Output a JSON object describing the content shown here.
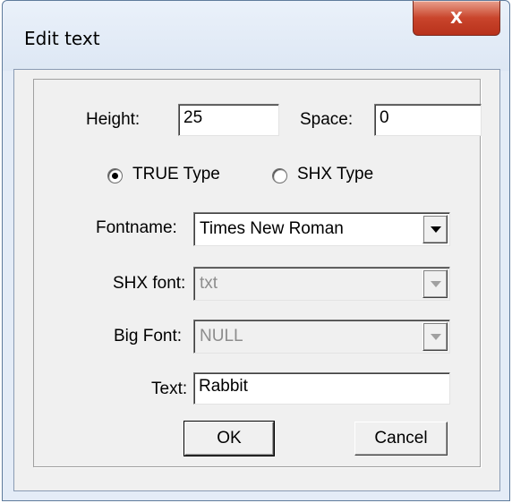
{
  "window": {
    "title": "Edit text",
    "close_glyph": "X"
  },
  "form": {
    "height_label": "Height:",
    "height_value": "25",
    "space_label": "Space:",
    "space_value": "0",
    "radio_true_label": "TRUE Type",
    "radio_shx_label": "SHX Type",
    "selected_type": "TRUE Type",
    "fontname_label": "Fontname:",
    "fontname_value": "Times New Roman",
    "shxfont_label": "SHX font:",
    "shxfont_value": "txt",
    "bigfont_label": "Big Font:",
    "bigfont_value": "NULL",
    "text_label": "Text:",
    "text_value": "Rabbit"
  },
  "buttons": {
    "ok": "OK",
    "cancel": "Cancel"
  },
  "icons": {
    "close": "close-icon",
    "dropdown": "chevron-down-icon"
  }
}
